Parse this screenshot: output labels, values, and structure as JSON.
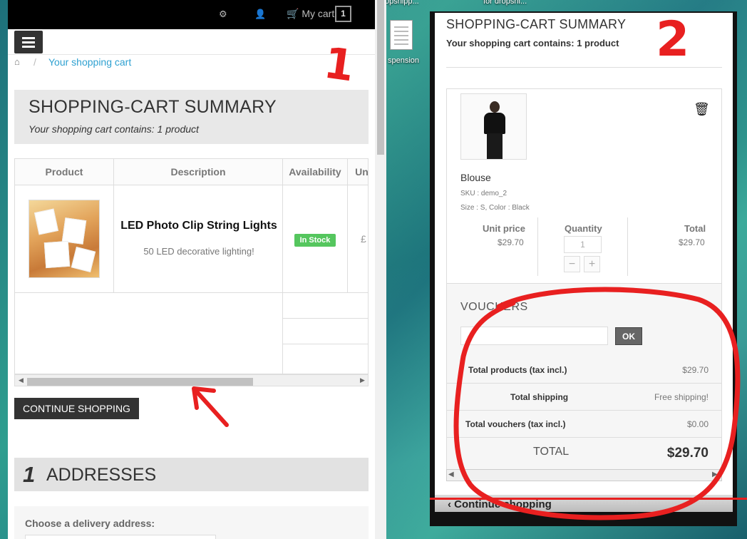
{
  "desktop": {
    "labels": [
      "opshipp...",
      "for dropshi...",
      "spension"
    ]
  },
  "left_window": {
    "cart_label": "My cart",
    "cart_count": "1",
    "breadcrumb_link": "Your shopping cart",
    "breadcrumb_sep": "/",
    "summary_title": "SHOPPING-CART SUMMARY",
    "summary_sub": "Your shopping cart contains: 1 product",
    "table": {
      "headers": [
        "Product",
        "Description",
        "Availability",
        "Un"
      ],
      "product_name": "LED Photo Clip String Lights",
      "product_desc": "50 LED decorative lighting!",
      "stock": "In Stock",
      "price_fragment": "£"
    },
    "continue_label": "CONTINUE SHOPPING",
    "addresses_num": "1",
    "addresses_title": "ADDRESSES",
    "delivery_label": "Choose a delivery address:"
  },
  "right_window": {
    "title": "SHOPPING-CART SUMMARY",
    "sub": "Your shopping cart contains: 1 product",
    "product_name": "Blouse",
    "sku": "SKU : demo_2",
    "attributes": "Size : S, Color : Black",
    "col_unit": "Unit price",
    "col_qty": "Quantity",
    "col_total": "Total",
    "unit_price": "$29.70",
    "qty": "1",
    "line_total": "$29.70",
    "minus": "−",
    "plus": "+",
    "voucher_title": "VOUCHERS",
    "ok_label": "OK",
    "rows": [
      {
        "label": "Total products (tax incl.)",
        "amount": "$29.70"
      },
      {
        "label": "Total shipping",
        "amount": "Free shipping!"
      },
      {
        "label": "Total vouchers (tax incl.)",
        "amount": "$0.00"
      }
    ],
    "total_label": "TOTAL",
    "total_value": "$29.70",
    "continue_label": "Continue shopping"
  },
  "annotations": {
    "one": "1",
    "two": "2",
    "color": "#e82020"
  }
}
